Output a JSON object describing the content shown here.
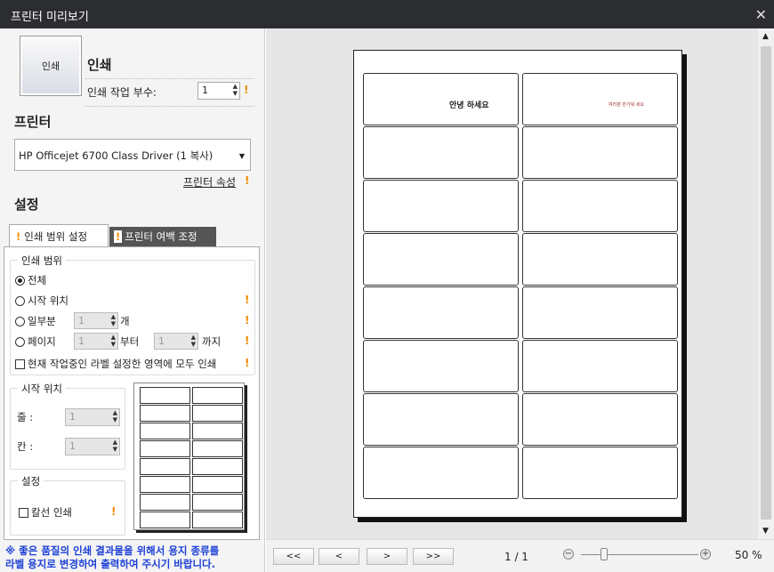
{
  "window": {
    "title": "프린터 미리보기",
    "close_icon": "close-icon"
  },
  "print": {
    "button_label": "인쇄",
    "heading": "인쇄",
    "copies_label": "인쇄 작업 부수:",
    "copies_value": "1"
  },
  "printer": {
    "heading": "프린터",
    "selected": "HP Officejet 6700 Class Driver (1 복사)",
    "properties_link": "프린터 속성"
  },
  "settings": {
    "heading": "설정",
    "tabs": [
      "인쇄 범위 설정",
      "프린터 여백 조정"
    ]
  },
  "range": {
    "group_title": "인쇄 범위",
    "all": "전체",
    "start_pos": "시작 위치",
    "partial": "일부분",
    "partial_value": "1",
    "partial_unit": "개",
    "page": "페이지",
    "page_from": "1",
    "from_suffix": "부터",
    "page_to": "1",
    "to_suffix": "까지",
    "current_area": "현재 작업중인 라벨 설정한 영역에 모두 인쇄"
  },
  "start": {
    "group_title": "시작 위치",
    "row_label": "줄 :",
    "row_value": "1",
    "col_label": "칸 :",
    "col_value": "1"
  },
  "opts": {
    "group_title": "설정",
    "cutline": "칼선 인쇄"
  },
  "notice": {
    "line1": "※ 좋은 품질의 인쇄 결과물을 위해서 용지 종류를",
    "line2": "라벨 용지로 변경하여 출력하여 주시기 바랍니다."
  },
  "preview": {
    "label1_text": "안녕 하세요",
    "label2_text": "여러분 반가워 세요",
    "rows": 8,
    "cols": 2
  },
  "footer": {
    "first": "<<",
    "prev": "<",
    "next": ">",
    "last": ">>",
    "page_indicator": "1 / 1",
    "zoom_out": "−",
    "zoom_in": "+",
    "zoom_level": "50 %",
    "zoom_fraction": 0.2
  },
  "colors": {
    "warning": "#f08c00",
    "notice": "#1c3fd6",
    "titlebar": "#2b2d31"
  }
}
